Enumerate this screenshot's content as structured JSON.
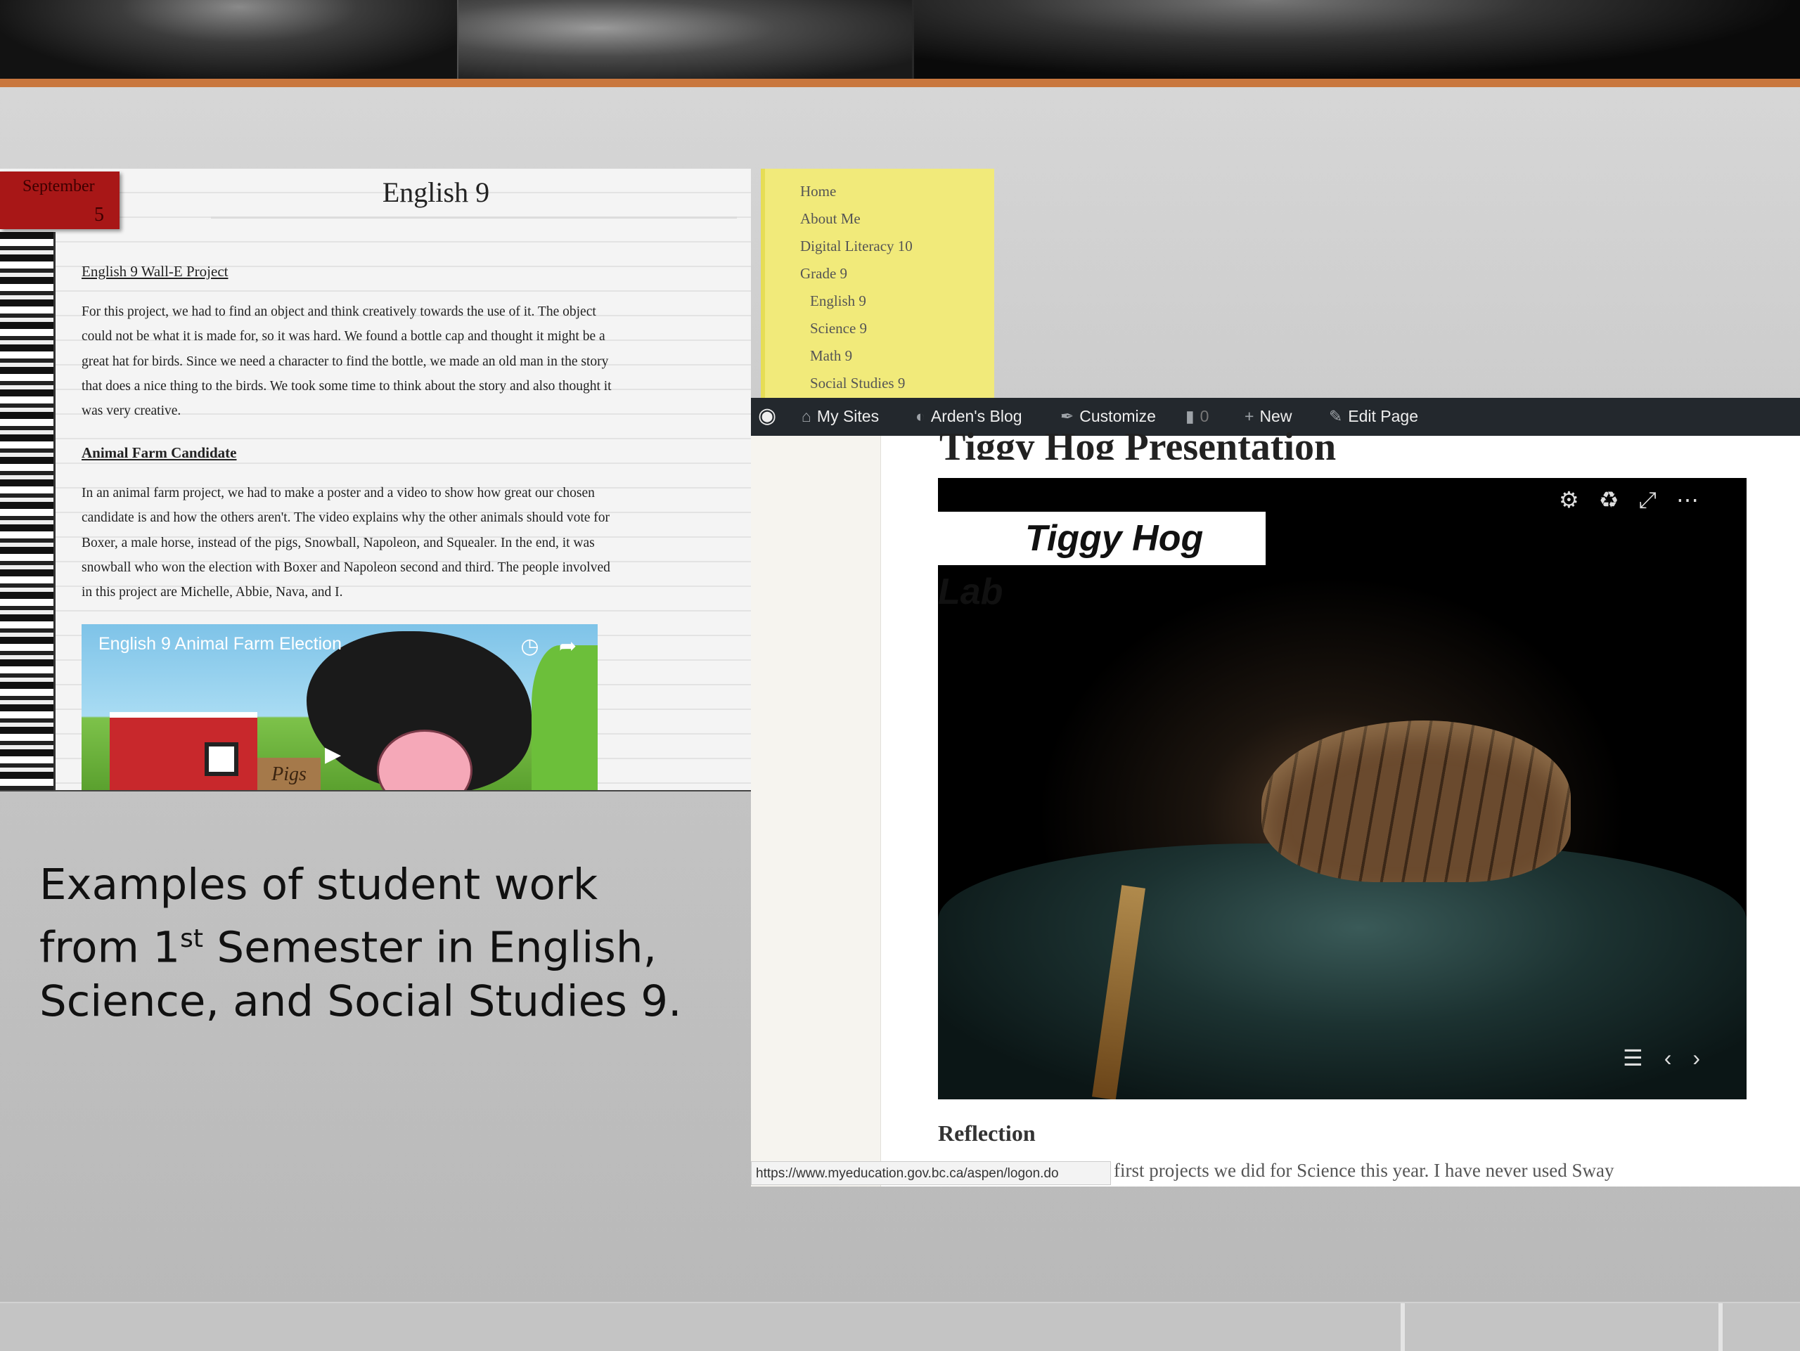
{
  "english_blog": {
    "date_month": "September",
    "date_day": "5",
    "title": "English 9",
    "section1_heading": "English 9 Wall-E Project",
    "section1_lines": [
      "For this project, we had to find an object and think creatively towards the use of it. The object",
      "could not be what it is made for, so it was hard. We found a bottle cap and thought it might be a",
      "great hat for birds. Since we need a character to find the bottle, we made an old man in the story",
      "that does a nice thing to the birds. We took some time to think about the story and also thought it",
      "was very creative."
    ],
    "section2_heading": "Animal Farm Candidate",
    "section2_lines": [
      "In an animal farm project, we had to make a poster and a video to show how great our chosen",
      "candidate is and how the others aren't. The video explains why the other animals should vote for",
      "Boxer, a male horse, instead of the pigs, Snowball, Napoleon, and Squealer. In the end, it was",
      "snowball who won the election with Boxer and Napoleon second and third. The people involved",
      "in this project are Michelle, Abbie, Nava, and I."
    ],
    "video_title": "English 9 Animal Farm Election",
    "video_sign": "Pigs"
  },
  "nav": {
    "items": [
      {
        "label": "Home"
      },
      {
        "label": "About Me"
      },
      {
        "label": "Digital Literacy 10"
      },
      {
        "label": "Grade 9"
      },
      {
        "label": "English 9"
      },
      {
        "label": "Science 9"
      },
      {
        "label": "Math 9"
      },
      {
        "label": "Social Studies 9"
      }
    ]
  },
  "admin_bar": {
    "my_sites": "My Sites",
    "blog": "Arden's Blog",
    "customize": "Customize",
    "comments": "0",
    "new": "New",
    "edit_page": "Edit Page"
  },
  "wp_page": {
    "heading": "Tiggy Hog Presentation",
    "sway_title": "Tiggy Hog Lab",
    "reflection": "Reflection",
    "body_snippet": "first projects we did for Science this year. I have never used Sway",
    "status_url": "https://www.myeducation.gov.bc.ca/aspen/logon.do"
  },
  "caption": {
    "line1": "Examples of student work",
    "line2_pre": "from 1",
    "line2_sup": "st",
    "line2_post": " Semester in English,",
    "line3": "Science, and Social Studies 9."
  }
}
